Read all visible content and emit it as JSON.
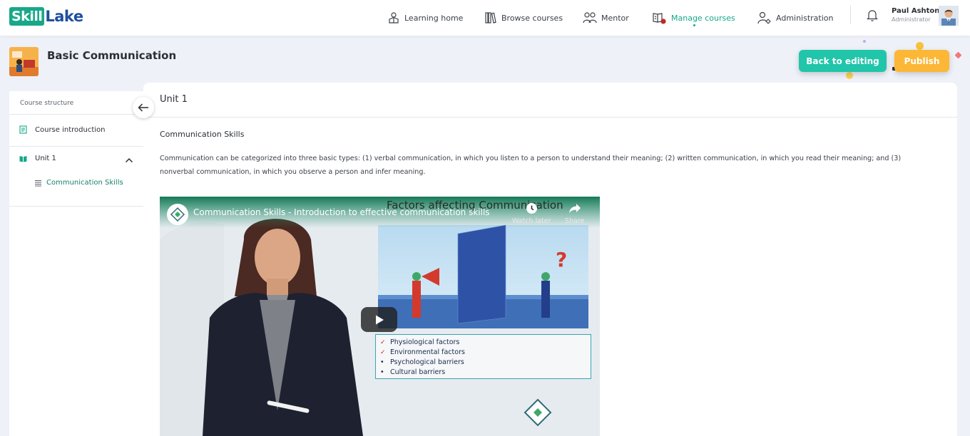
{
  "brand": {
    "logo_left": "Skill",
    "logo_right": "Lake",
    "accent": "#17a889",
    "logo_blue": "#1f4fa0"
  },
  "nav": {
    "items": [
      {
        "label": "Learning home",
        "icon": "learning-home-icon"
      },
      {
        "label": "Browse courses",
        "icon": "books-icon"
      },
      {
        "label": "Mentor",
        "icon": "mentor-icon"
      },
      {
        "label": "Manage courses",
        "icon": "manage-courses-icon",
        "active": true
      },
      {
        "label": "Administration",
        "icon": "admin-gear-icon"
      }
    ]
  },
  "user": {
    "name": "Paul Ashton",
    "role": "Administrator"
  },
  "course": {
    "title": "Basic Communication"
  },
  "actions": {
    "back_to_editing": "Back to editing",
    "publish": "Publish",
    "back_color": "#20c5aa",
    "publish_color": "#fbb735"
  },
  "sidebar": {
    "heading": "Course structure",
    "items": [
      {
        "label": "Course introduction",
        "icon": "document-icon"
      },
      {
        "label": "Unit 1",
        "icon": "book-open-icon",
        "expanded": true,
        "children": [
          {
            "label": "Communication Skills",
            "icon": "lines-icon",
            "active": true
          }
        ]
      }
    ]
  },
  "content": {
    "unit_title": "Unit 1",
    "section_title": "Communication Skills",
    "description": "Communication can be categorized into three basic types: (1) verbal communication, in which you listen to a person to understand their meaning; (2) written communication, in which you read their meaning; and (3) nonverbal communication, in which you observe a person and infer meaning."
  },
  "video": {
    "title": "Communication Skills - Introduction to effective communication skills",
    "watch_later": "Watch later",
    "share": "Share",
    "slide_title": "Factors affecting Communication",
    "slide_points": [
      {
        "text": "Physiological factors",
        "checked": true
      },
      {
        "text": "Environmental factors",
        "checked": true
      },
      {
        "text": "Psychological barriers",
        "checked": false
      },
      {
        "text": "Cultural barriers",
        "checked": false
      }
    ]
  }
}
